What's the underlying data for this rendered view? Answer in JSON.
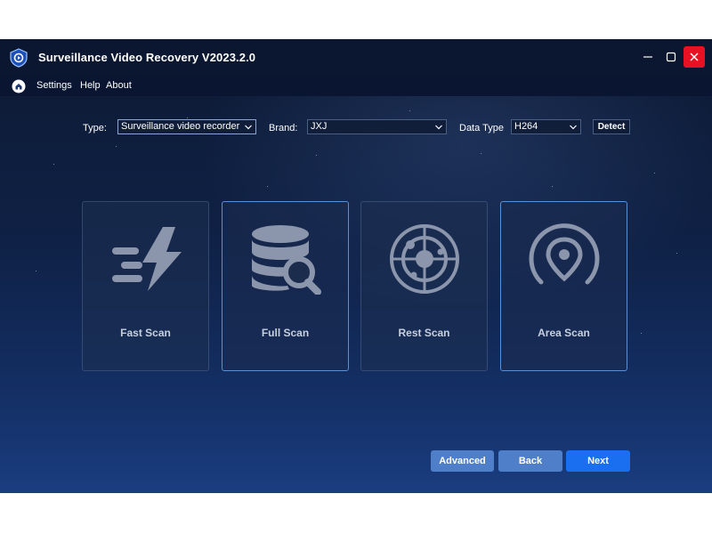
{
  "window": {
    "title": "Surveillance Video Recovery V2023.2.0",
    "controls": {
      "minimize": "minimize-icon",
      "maximize": "maximize-icon",
      "close": "close-icon"
    }
  },
  "menu": {
    "items": [
      {
        "label": "Settings"
      },
      {
        "label": "Help"
      },
      {
        "label": "About"
      }
    ]
  },
  "filters": {
    "type": {
      "label": "Type:",
      "value": "Surveillance video recorder"
    },
    "brand": {
      "label": "Brand:",
      "value": "JXJ"
    },
    "data_type": {
      "label": "Data Type",
      "value": "H264"
    },
    "detect_label": "Detect"
  },
  "scan_modes": [
    {
      "label": "Fast Scan",
      "icon": "lightning-icon"
    },
    {
      "label": "Full Scan",
      "icon": "database-search-icon"
    },
    {
      "label": "Rest Scan",
      "icon": "radar-icon"
    },
    {
      "label": "Area Scan",
      "icon": "location-pin-icon"
    }
  ],
  "footer": {
    "advanced_label": "Advanced",
    "back_label": "Back",
    "next_label": "Next"
  },
  "colors": {
    "accent": "#1a6ff0",
    "secondary_button": "#4f7fc8",
    "close_button": "#e81123",
    "icon_gray": "#8b95ab"
  }
}
